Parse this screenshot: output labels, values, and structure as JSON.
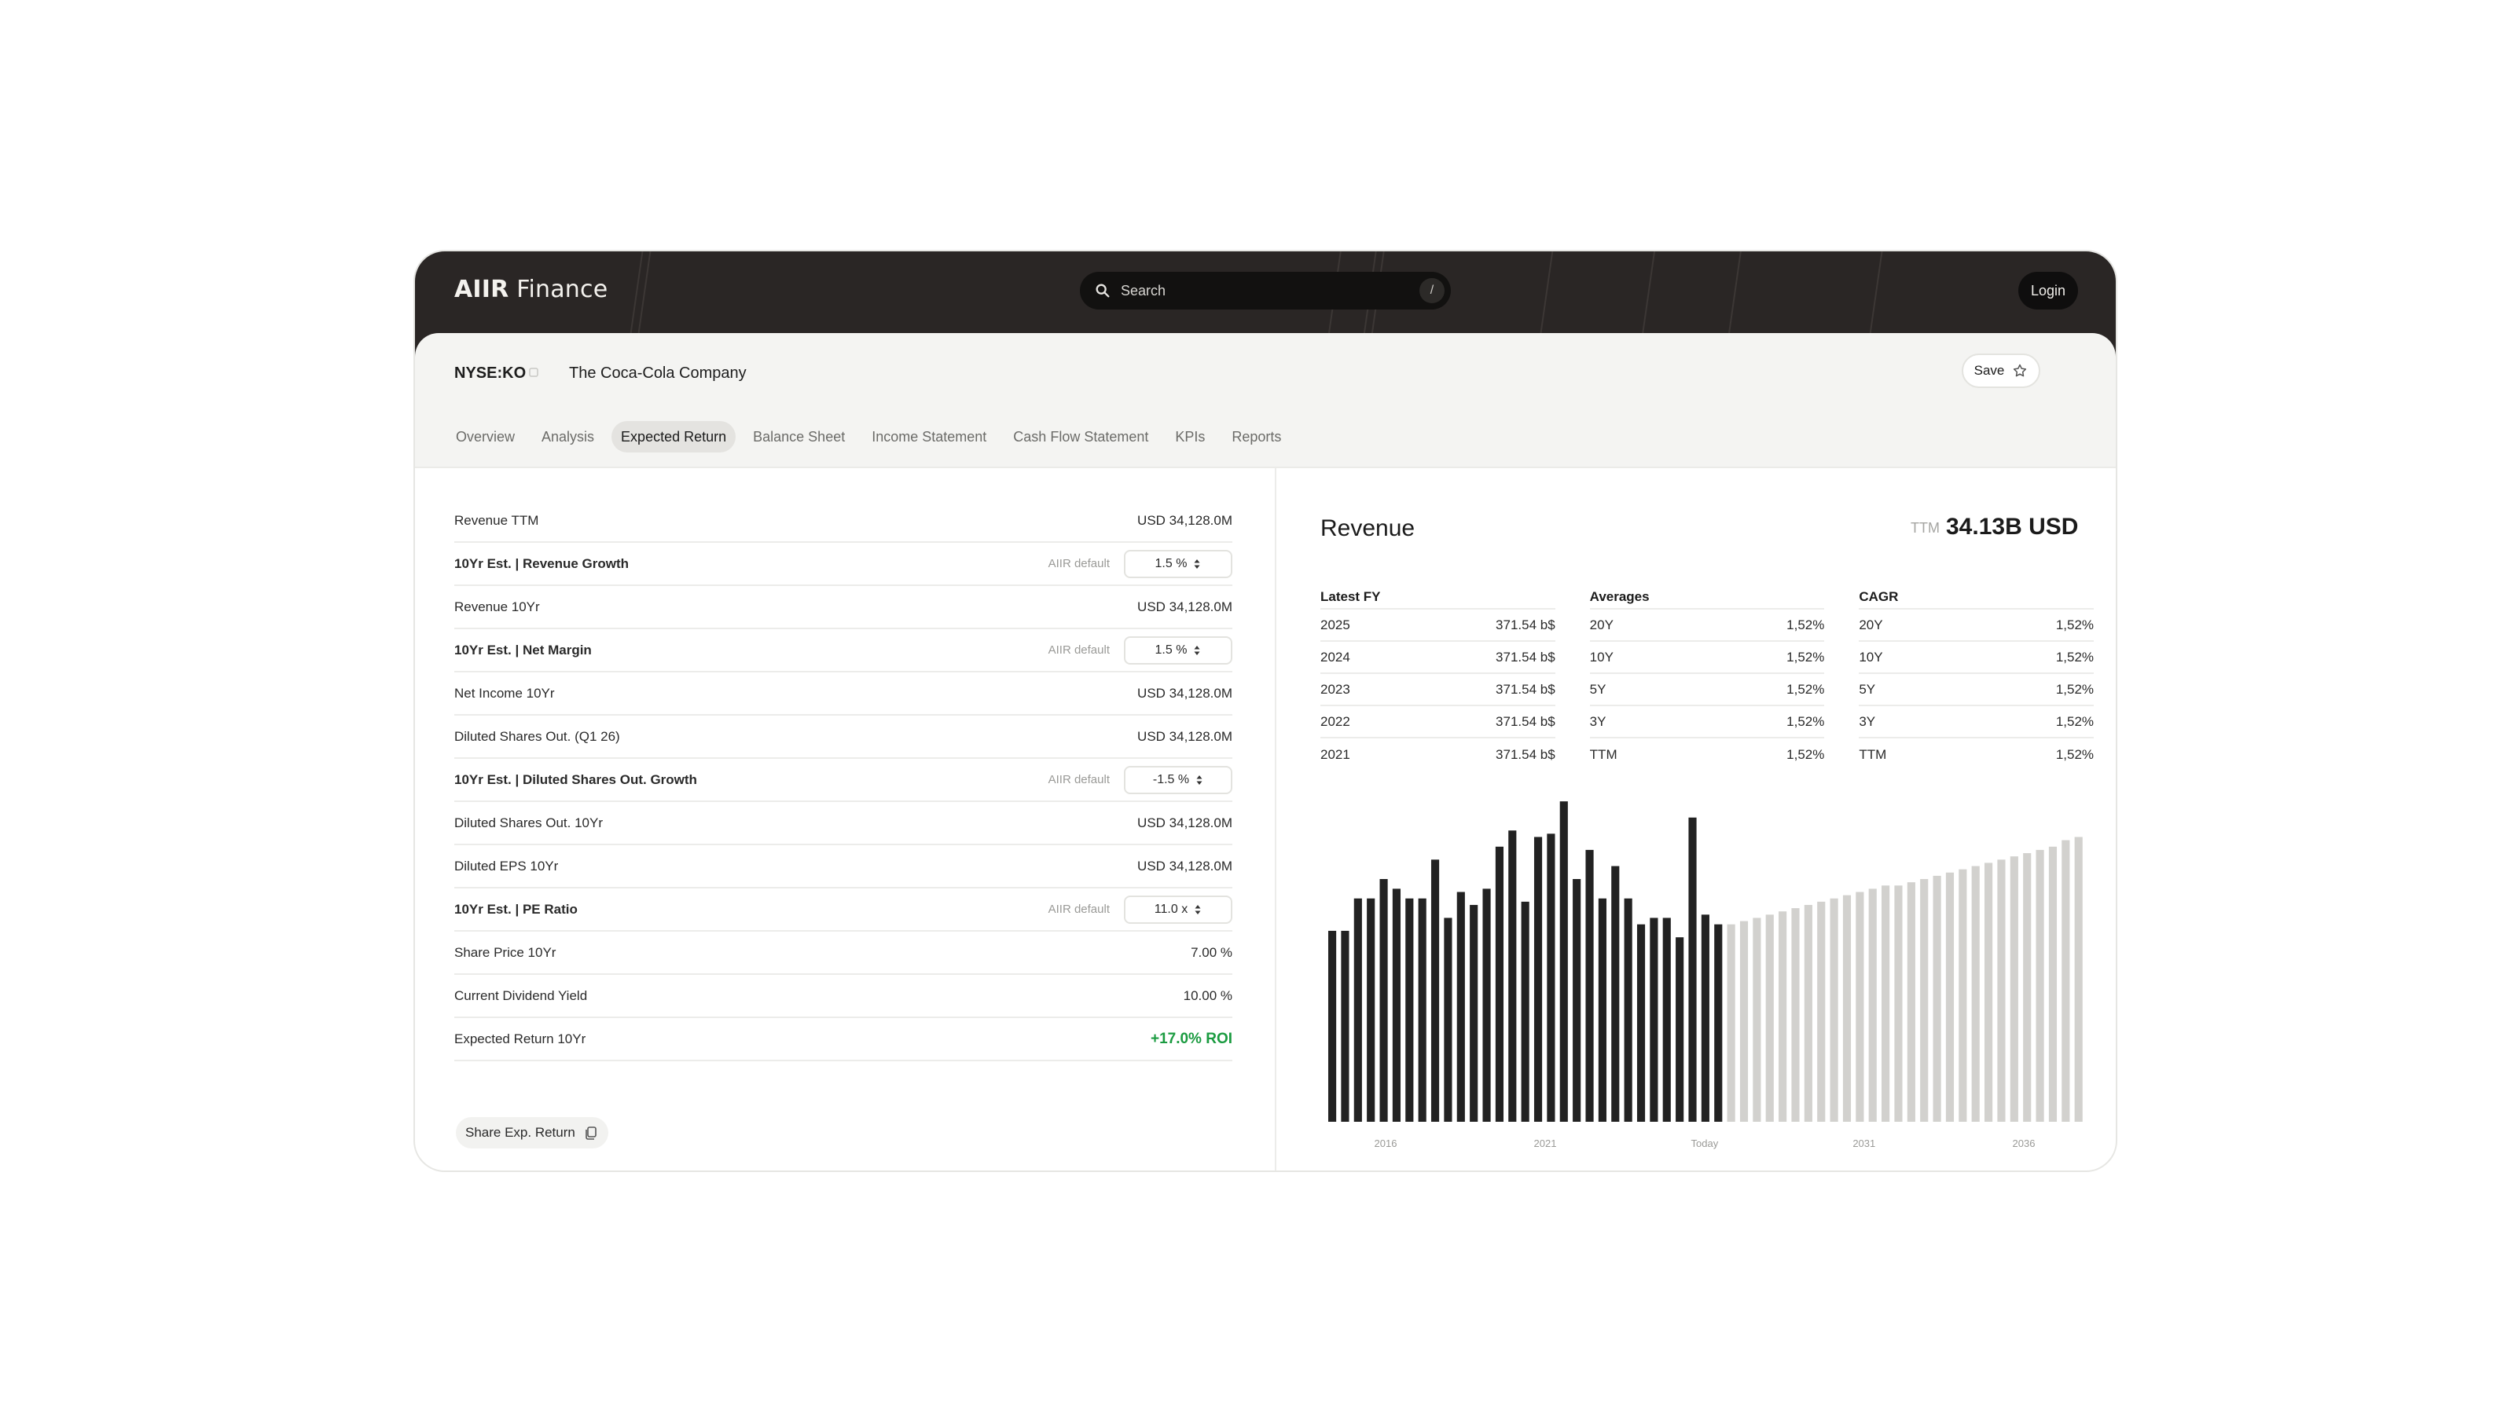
{
  "app": {
    "logo_bold": "AIIR",
    "logo_light": " Finance",
    "search_placeholder": "Search",
    "search_shortcut": "/",
    "login_label": "Login"
  },
  "header": {
    "ticker": "NYSE:KO",
    "company": "The Coca-Cola Company",
    "save_label": "Save",
    "tabs": [
      {
        "label": "Overview",
        "active": false
      },
      {
        "label": "Analysis",
        "active": false
      },
      {
        "label": "Expected Return",
        "active": true
      },
      {
        "label": "Balance Sheet",
        "active": false
      },
      {
        "label": "Income Statement",
        "active": false
      },
      {
        "label": "Cash Flow Statement",
        "active": false
      },
      {
        "label": "KPIs",
        "active": false
      },
      {
        "label": "Reports",
        "active": false
      }
    ]
  },
  "calc": {
    "default_label": "AIIR default",
    "rows": [
      {
        "label": "Revenue TTM",
        "value": "USD 34,128.0M"
      },
      {
        "label": "10Yr Est. | Revenue Growth",
        "input": "1.5 %"
      },
      {
        "label": "Revenue 10Yr",
        "value": "USD 34,128.0M"
      },
      {
        "label": "10Yr Est. | Net Margin",
        "input": "1.5 %"
      },
      {
        "label": "Net Income 10Yr",
        "value": "USD 34,128.0M"
      },
      {
        "label": "Diluted Shares Out. (Q1 26)",
        "value": "USD 34,128.0M"
      },
      {
        "label": "10Yr Est. | Diluted Shares Out. Growth",
        "input": "-1.5 %"
      },
      {
        "label": "Diluted Shares Out. 10Yr",
        "value": "USD 34,128.0M"
      },
      {
        "label": "Diluted EPS 10Yr",
        "value": "USD 34,128.0M"
      },
      {
        "label": "10Yr Est. | PE Ratio",
        "input": "11.0 x"
      },
      {
        "label": "Share Price 10Yr",
        "value": "7.00 %"
      },
      {
        "label": "Current Dividend Yield",
        "value": "10.00 %"
      },
      {
        "label": "Expected Return 10Yr",
        "value": "+17.0% ROI",
        "highlight": true
      }
    ],
    "share_label": "Share Exp. Return"
  },
  "revenue": {
    "title": "Revenue",
    "ttm_label": "TTM",
    "ttm_value": "34.13B USD",
    "columns": [
      {
        "title": "Latest FY",
        "rows": [
          [
            "2025",
            "371.54 b$"
          ],
          [
            "2024",
            "371.54 b$"
          ],
          [
            "2023",
            "371.54 b$"
          ],
          [
            "2022",
            "371.54 b$"
          ],
          [
            "2021",
            "371.54 b$"
          ]
        ]
      },
      {
        "title": "Averages",
        "rows": [
          [
            "20Y",
            "1,52%"
          ],
          [
            "10Y",
            "1,52%"
          ],
          [
            "5Y",
            "1,52%"
          ],
          [
            "3Y",
            "1,52%"
          ],
          [
            "TTM",
            "1,52%"
          ]
        ]
      },
      {
        "title": "CAGR",
        "rows": [
          [
            "20Y",
            "1,52%"
          ],
          [
            "10Y",
            "1,52%"
          ],
          [
            "5Y",
            "1,52%"
          ],
          [
            "3Y",
            "1,52%"
          ],
          [
            "TTM",
            "1,52%"
          ]
        ]
      }
    ]
  },
  "chart_data": {
    "type": "bar",
    "x_tick_labels": [
      "2016",
      "2021",
      "Today",
      "2031",
      "2036"
    ],
    "series": [
      {
        "kind": "historical",
        "color": "#222222",
        "values": [
          59,
          59,
          69,
          69,
          75,
          72,
          69,
          69,
          81,
          63,
          71,
          67,
          72,
          85,
          90,
          68,
          88,
          89,
          99,
          75,
          84,
          69,
          79,
          69,
          61,
          63,
          63,
          57,
          94,
          64,
          61
        ]
      },
      {
        "kind": "projected",
        "color": "#d2d1ce",
        "values": [
          61,
          62,
          63,
          64,
          65,
          66,
          67,
          68,
          69,
          70,
          71,
          72,
          73,
          73,
          74,
          75,
          76,
          77,
          78,
          79,
          80,
          81,
          82,
          83,
          84,
          85,
          87,
          88
        ]
      }
    ],
    "ylim": [
      0,
      100
    ],
    "grid": false
  }
}
